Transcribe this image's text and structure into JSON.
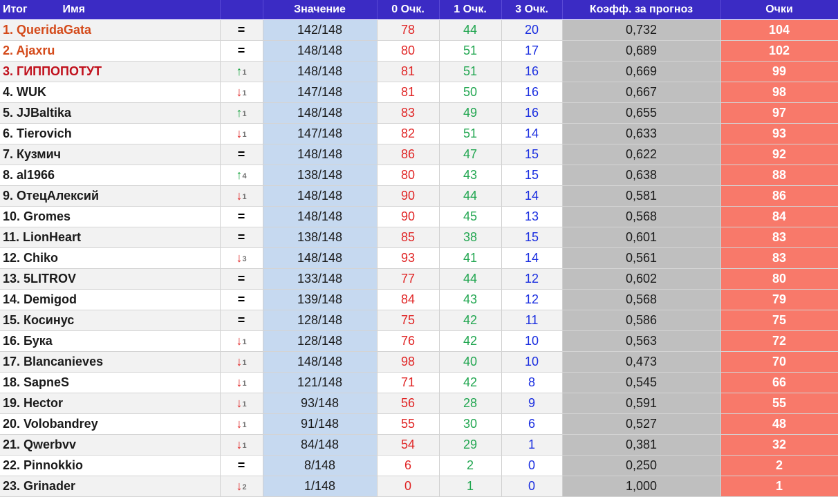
{
  "headers": {
    "itog": "Итог",
    "name": "Имя",
    "change": "",
    "value": "Значение",
    "p0": "0 Очк.",
    "p1": "1 Очк.",
    "p3": "3 Очк.",
    "coef": "Коэфф. за прогноз",
    "points": "Очки"
  },
  "colors": {
    "header_bg": "#3b2bc4",
    "value_bg": "#c6d9f0",
    "coef_bg": "#bfbfbf",
    "points_bg": "#f8796a",
    "zero_points": "#e02424",
    "one_point": "#21a650",
    "three_points": "#1a2ee0",
    "arrow_up": "#14a23c",
    "arrow_down": "#e02020"
  },
  "rows": [
    {
      "name": "1. QueridaGata",
      "change": {
        "dir": "same",
        "symbol": "=",
        "amount": ""
      },
      "value": "142/148",
      "p0": "78",
      "p1": "44",
      "p3": "20",
      "coef": "0,732",
      "points": "104"
    },
    {
      "name": "2. Ajaxru",
      "change": {
        "dir": "same",
        "symbol": "=",
        "amount": ""
      },
      "value": "148/148",
      "p0": "80",
      "p1": "51",
      "p3": "17",
      "coef": "0,689",
      "points": "102"
    },
    {
      "name": "3. ГИППОПОТУТ",
      "change": {
        "dir": "up",
        "symbol": "↑",
        "amount": "1"
      },
      "value": "148/148",
      "p0": "81",
      "p1": "51",
      "p3": "16",
      "coef": "0,669",
      "points": "99"
    },
    {
      "name": "4. WUK",
      "change": {
        "dir": "down",
        "symbol": "↓",
        "amount": "1"
      },
      "value": "147/148",
      "p0": "81",
      "p1": "50",
      "p3": "16",
      "coef": "0,667",
      "points": "98"
    },
    {
      "name": "5. JJBaltika",
      "change": {
        "dir": "up",
        "symbol": "↑",
        "amount": "1"
      },
      "value": "148/148",
      "p0": "83",
      "p1": "49",
      "p3": "16",
      "coef": "0,655",
      "points": "97"
    },
    {
      "name": "6. Tierovich",
      "change": {
        "dir": "down",
        "symbol": "↓",
        "amount": "1"
      },
      "value": "147/148",
      "p0": "82",
      "p1": "51",
      "p3": "14",
      "coef": "0,633",
      "points": "93"
    },
    {
      "name": "7. Кузмич",
      "change": {
        "dir": "same",
        "symbol": "=",
        "amount": ""
      },
      "value": "148/148",
      "p0": "86",
      "p1": "47",
      "p3": "15",
      "coef": "0,622",
      "points": "92"
    },
    {
      "name": "8. al1966",
      "change": {
        "dir": "up",
        "symbol": "↑",
        "amount": "4"
      },
      "value": "138/148",
      "p0": "80",
      "p1": "43",
      "p3": "15",
      "coef": "0,638",
      "points": "88"
    },
    {
      "name": "9. ОтецАлексий",
      "change": {
        "dir": "down",
        "symbol": "↓",
        "amount": "1"
      },
      "value": "148/148",
      "p0": "90",
      "p1": "44",
      "p3": "14",
      "coef": "0,581",
      "points": "86"
    },
    {
      "name": "10. Gromes",
      "change": {
        "dir": "same",
        "symbol": "=",
        "amount": ""
      },
      "value": "148/148",
      "p0": "90",
      "p1": "45",
      "p3": "13",
      "coef": "0,568",
      "points": "84"
    },
    {
      "name": "11. LionHeart",
      "change": {
        "dir": "same",
        "symbol": "=",
        "amount": ""
      },
      "value": "138/148",
      "p0": "85",
      "p1": "38",
      "p3": "15",
      "coef": "0,601",
      "points": "83"
    },
    {
      "name": "12. Chiko",
      "change": {
        "dir": "down",
        "symbol": "↓",
        "amount": "3"
      },
      "value": "148/148",
      "p0": "93",
      "p1": "41",
      "p3": "14",
      "coef": "0,561",
      "points": "83"
    },
    {
      "name": "13. 5LITROV",
      "change": {
        "dir": "same",
        "symbol": "=",
        "amount": ""
      },
      "value": "133/148",
      "p0": "77",
      "p1": "44",
      "p3": "12",
      "coef": "0,602",
      "points": "80"
    },
    {
      "name": "14. Demigod",
      "change": {
        "dir": "same",
        "symbol": "=",
        "amount": ""
      },
      "value": "139/148",
      "p0": "84",
      "p1": "43",
      "p3": "12",
      "coef": "0,568",
      "points": "79"
    },
    {
      "name": "15. Косинус",
      "change": {
        "dir": "same",
        "symbol": "=",
        "amount": ""
      },
      "value": "128/148",
      "p0": "75",
      "p1": "42",
      "p3": "11",
      "coef": "0,586",
      "points": "75"
    },
    {
      "name": "16. Бука",
      "change": {
        "dir": "down",
        "symbol": "↓",
        "amount": "1"
      },
      "value": "128/148",
      "p0": "76",
      "p1": "42",
      "p3": "10",
      "coef": "0,563",
      "points": "72"
    },
    {
      "name": "17. Blancanieves",
      "change": {
        "dir": "down",
        "symbol": "↓",
        "amount": "1"
      },
      "value": "148/148",
      "p0": "98",
      "p1": "40",
      "p3": "10",
      "coef": "0,473",
      "points": "70"
    },
    {
      "name": "18. SapneS",
      "change": {
        "dir": "down",
        "symbol": "↓",
        "amount": "1"
      },
      "value": "121/148",
      "p0": "71",
      "p1": "42",
      "p3": "8",
      "coef": "0,545",
      "points": "66"
    },
    {
      "name": "19. Hector",
      "change": {
        "dir": "down",
        "symbol": "↓",
        "amount": "1"
      },
      "value": "93/148",
      "p0": "56",
      "p1": "28",
      "p3": "9",
      "coef": "0,591",
      "points": "55"
    },
    {
      "name": "20. Volobandrey",
      "change": {
        "dir": "down",
        "symbol": "↓",
        "amount": "1"
      },
      "value": "91/148",
      "p0": "55",
      "p1": "30",
      "p3": "6",
      "coef": "0,527",
      "points": "48"
    },
    {
      "name": "21. Qwerbvv",
      "change": {
        "dir": "down",
        "symbol": "↓",
        "amount": "1"
      },
      "value": "84/148",
      "p0": "54",
      "p1": "29",
      "p3": "1",
      "coef": "0,381",
      "points": "32"
    },
    {
      "name": "22. Pinnokkio",
      "change": {
        "dir": "same",
        "symbol": "=",
        "amount": ""
      },
      "value": "8/148",
      "p0": "6",
      "p1": "2",
      "p3": "0",
      "coef": "0,250",
      "points": "2"
    },
    {
      "name": "23. Grinader",
      "change": {
        "dir": "down",
        "symbol": "↓",
        "amount": "2"
      },
      "value": "1/148",
      "p0": "0",
      "p1": "1",
      "p3": "0",
      "coef": "1,000",
      "points": "1"
    }
  ]
}
